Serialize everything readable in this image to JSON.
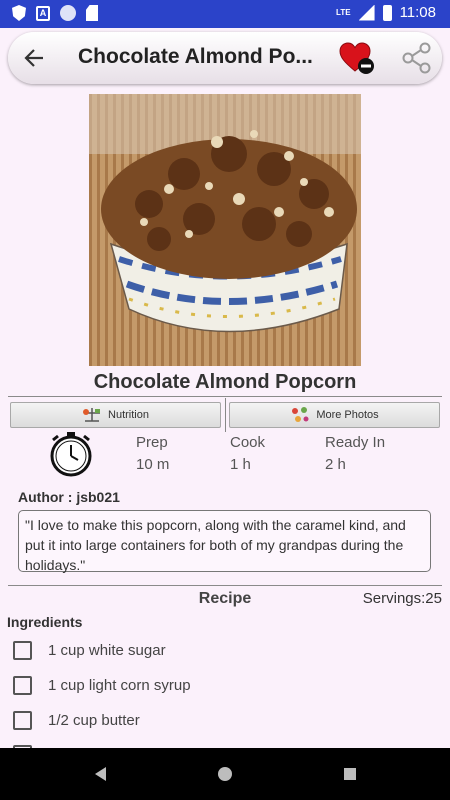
{
  "status_bar": {
    "time": "11:08",
    "network": "LTE",
    "icons": [
      "shield-icon",
      "a-icon",
      "circle-icon",
      "sd-card-icon",
      "signal-icon",
      "battery-icon"
    ]
  },
  "toolbar": {
    "title": "Chocolate Almond Po...",
    "back_icon": "arrow-left-icon",
    "favorite_icon": "heart-remove-icon",
    "share_icon": "share-icon"
  },
  "recipe": {
    "title": "Chocolate Almond Popcorn",
    "nutrition_label": "Nutrition",
    "photos_label": "More Photos",
    "times": {
      "prep_label": "Prep",
      "prep_value": "10 m",
      "cook_label": "Cook",
      "cook_value": "1 h",
      "ready_label": "Ready In",
      "ready_value": "2 h"
    },
    "author": "Author : jsb021",
    "description": "\"I love to make this popcorn, along with the caramel kind, and put it into large containers for both of my grandpas during the holidays.\"",
    "section_title": "Recipe",
    "servings": "Servings:25",
    "ingredients_title": "Ingredients",
    "ingredients": [
      "1 cup white sugar",
      "1 cup light corn syrup",
      "1/2 cup butter"
    ]
  },
  "colors": {
    "status_bar": "#2b43c9",
    "background": "#fbf1fb",
    "heart": "#d8121b"
  }
}
